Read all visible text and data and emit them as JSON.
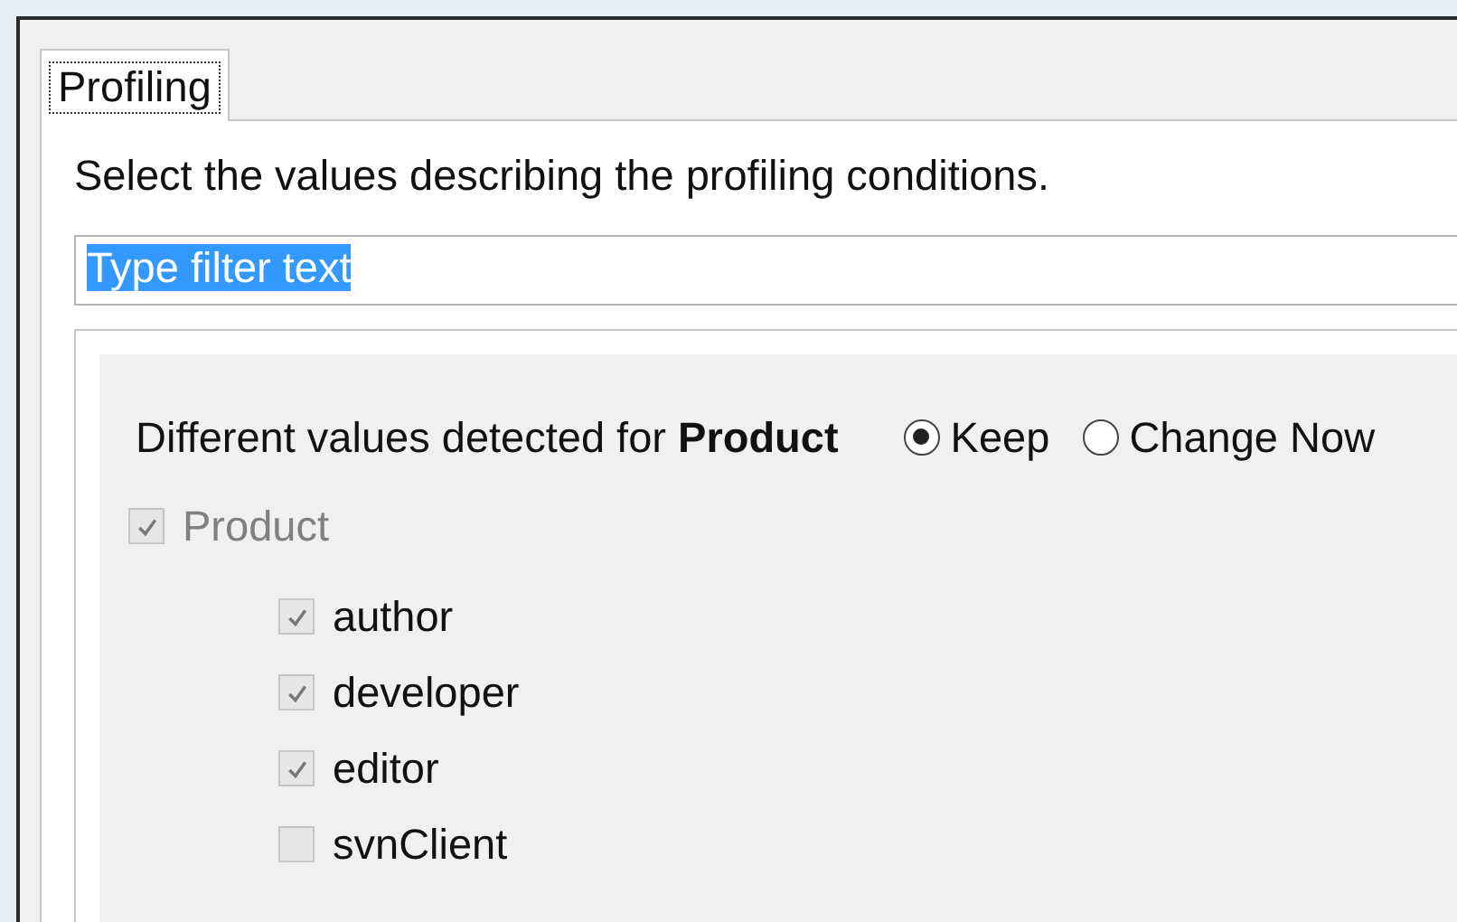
{
  "tabs": [
    {
      "label": "Profiling",
      "selected": true
    }
  ],
  "description": "Select the values describing the profiling conditions.",
  "filter": {
    "value": "Type filter text",
    "text_selected": true
  },
  "group": {
    "heading": "Different values detected for **Product**",
    "options": [
      {
        "label": "Keep",
        "selected": true
      },
      {
        "label": "Change Now",
        "selected": false
      }
    ],
    "parent": {
      "label": "Product",
      "checked": true,
      "disabled": true
    },
    "items": [
      {
        "label": "author",
        "checked": true
      },
      {
        "label": "developer",
        "checked": true
      },
      {
        "label": "editor",
        "checked": true
      },
      {
        "label": "svnClient",
        "checked": false
      }
    ]
  }
}
